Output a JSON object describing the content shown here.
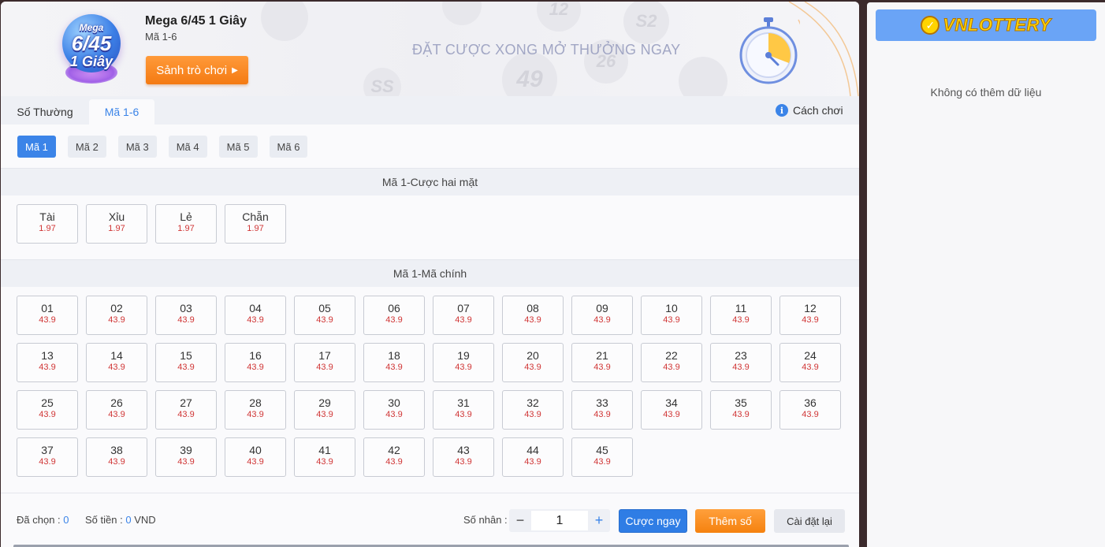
{
  "header": {
    "logo_line1": "Mega",
    "logo_line2": "6/45",
    "logo_line3": "1 Giây",
    "title": "Mega 6/45 1 Giây",
    "subtitle": "Mã 1-6",
    "lobby_button": "Sảnh trò chơi",
    "slogan": "ĐẶT CƯỢC XONG MỞ THƯỞNG NGAY",
    "bg_balls": [
      "12",
      "S2",
      "49",
      "SS",
      "26"
    ]
  },
  "tabs": [
    {
      "label": "Số Thường",
      "active": false
    },
    {
      "label": "Mã 1-6",
      "active": true
    }
  ],
  "how_to_play": "Cách chơi",
  "subtabs": [
    {
      "label": "Mã 1",
      "active": true
    },
    {
      "label": "Mã 2",
      "active": false
    },
    {
      "label": "Mã 3",
      "active": false
    },
    {
      "label": "Mã 4",
      "active": false
    },
    {
      "label": "Mã 5",
      "active": false
    },
    {
      "label": "Mã 6",
      "active": false
    }
  ],
  "two_sided": {
    "title": "Mã 1-Cược hai mặt",
    "options": [
      {
        "label": "Tài",
        "odds": "1.97"
      },
      {
        "label": "Xỉu",
        "odds": "1.97"
      },
      {
        "label": "Lẻ",
        "odds": "1.97"
      },
      {
        "label": "Chẵn",
        "odds": "1.97"
      }
    ]
  },
  "main_numbers": {
    "title": "Mã 1-Mã chính",
    "odds": "43.9",
    "numbers": [
      "01",
      "02",
      "03",
      "04",
      "05",
      "06",
      "07",
      "08",
      "09",
      "10",
      "11",
      "12",
      "13",
      "14",
      "15",
      "16",
      "17",
      "18",
      "19",
      "20",
      "21",
      "22",
      "23",
      "24",
      "25",
      "26",
      "27",
      "28",
      "29",
      "30",
      "31",
      "32",
      "33",
      "34",
      "35",
      "36",
      "37",
      "38",
      "39",
      "40",
      "41",
      "42",
      "43",
      "44",
      "45"
    ]
  },
  "footer": {
    "chosen_label": "Đã chọn :",
    "chosen_value": "0",
    "amount_label": "Số tiền :",
    "amount_value": "0",
    "currency": "VND",
    "multiplier_label": "Số nhân :",
    "multiplier_value": "1",
    "minus": "−",
    "plus": "+",
    "bet_button": "Cược ngay",
    "add_button": "Thêm số",
    "reset_button": "Cài đặt lại"
  },
  "sidebar": {
    "brand": "VNLOTTERY",
    "no_data": "Không có thêm dữ liệu"
  },
  "colors": {
    "accent": "#3b84e8",
    "orange": "#f5820f",
    "odds": "#d03535"
  }
}
